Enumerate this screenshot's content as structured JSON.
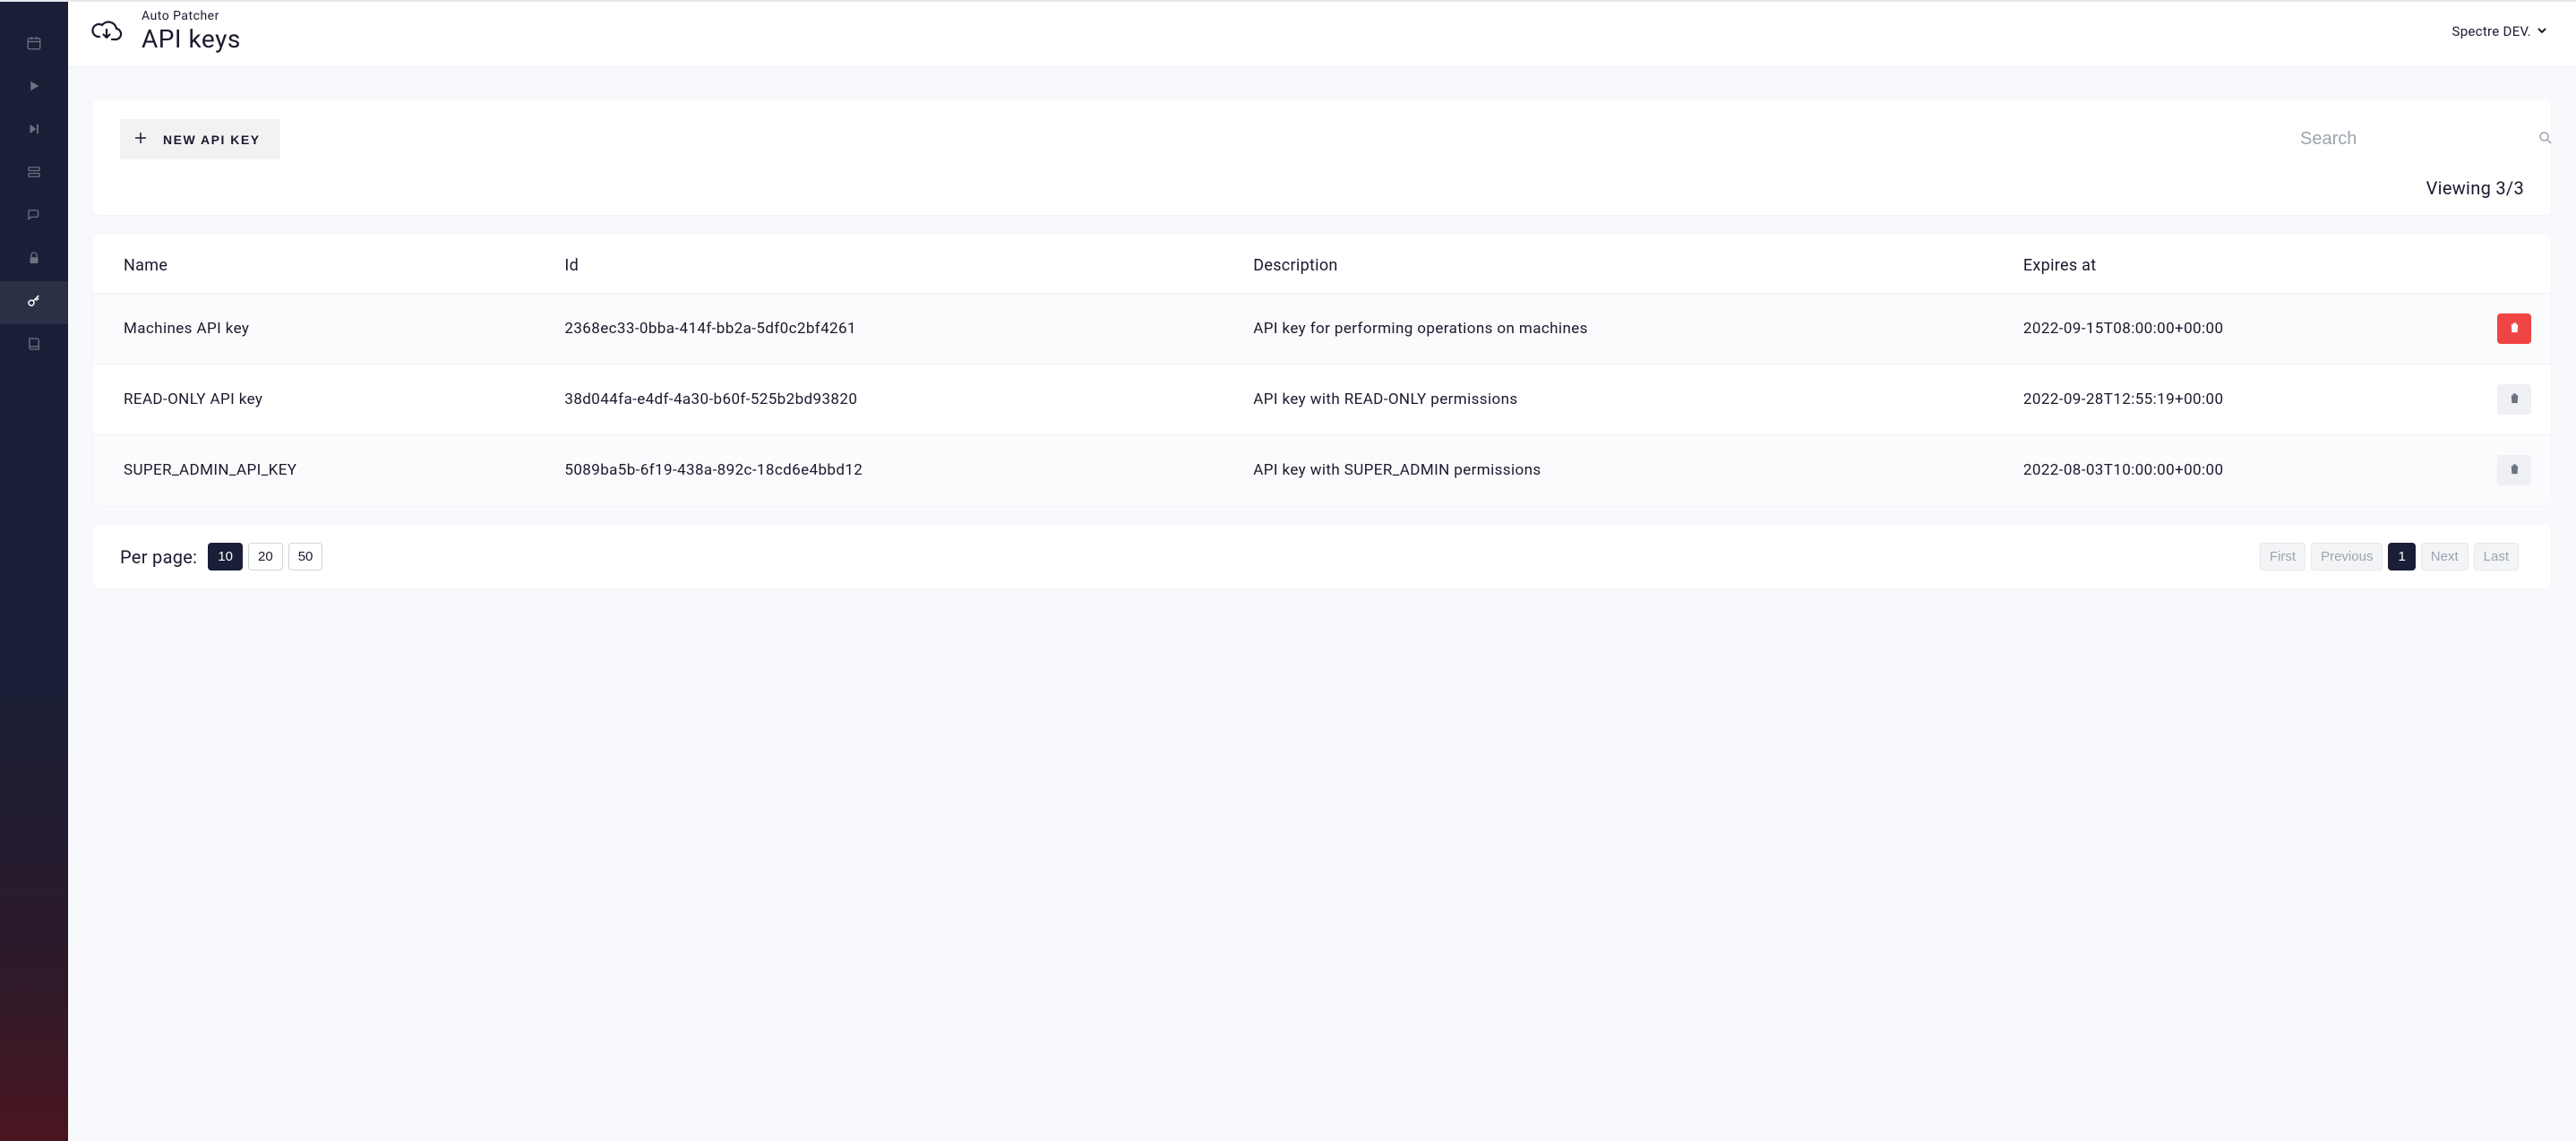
{
  "header": {
    "subtitle": "Auto Patcher",
    "title": "API keys",
    "user_name": "Spectre DEV."
  },
  "sidebar": {
    "items": [
      {
        "name": "calendar-icon"
      },
      {
        "name": "play-icon"
      },
      {
        "name": "skip-icon"
      },
      {
        "name": "server-icon"
      },
      {
        "name": "chat-icon"
      },
      {
        "name": "lock-icon"
      },
      {
        "name": "key-icon",
        "active": true
      },
      {
        "name": "book-icon"
      }
    ]
  },
  "toolbar": {
    "new_label": "NEW API KEY",
    "search_placeholder": "Search",
    "viewing_label": "Viewing 3/3"
  },
  "table": {
    "columns": [
      "Name",
      "Id",
      "Description",
      "Expires at"
    ],
    "rows": [
      {
        "name": "Machines API key",
        "id": "2368ec33-0bba-414f-bb2a-5df0c2bf4261",
        "description": "API key for performing operations on machines",
        "expires": "2022-09-15T08:00:00+00:00",
        "delete_style": "red"
      },
      {
        "name": "READ-ONLY API key",
        "id": "38d044fa-e4df-4a30-b60f-525b2bd93820",
        "description": "API key with READ-ONLY permissions",
        "expires": "2022-09-28T12:55:19+00:00",
        "delete_style": "gray"
      },
      {
        "name": "SUPER_ADMIN_API_KEY",
        "id": "5089ba5b-6f19-438a-892c-18cd6e4bbd12",
        "description": "API key with SUPER_ADMIN permissions",
        "expires": "2022-08-03T10:00:00+00:00",
        "delete_style": "gray"
      }
    ]
  },
  "pager": {
    "per_page_label": "Per page:",
    "per_page_options": [
      "10",
      "20",
      "50"
    ],
    "per_page_active": "10",
    "nav": {
      "first": "First",
      "previous": "Previous",
      "current": "1",
      "next": "Next",
      "last": "Last"
    }
  }
}
